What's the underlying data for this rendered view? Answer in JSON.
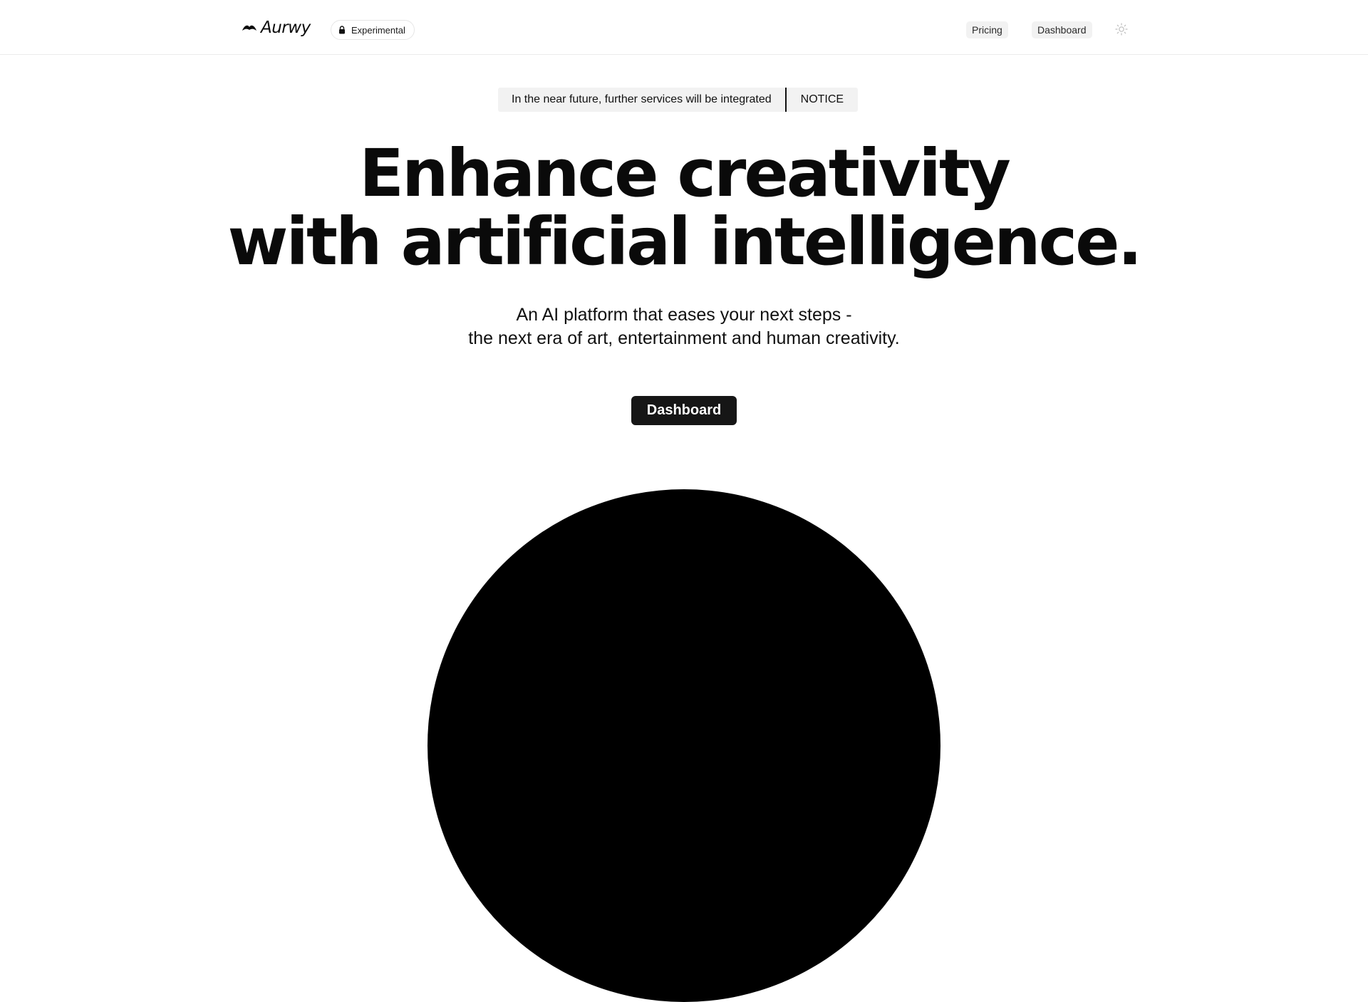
{
  "header": {
    "brand_name": "Aurwy",
    "badge_label": "Experimental",
    "nav": {
      "pricing": "Pricing",
      "dashboard": "Dashboard"
    },
    "theme_icon": "sun-icon"
  },
  "notice": {
    "text": "In the near future, further services will be integrated",
    "tag": "NOTICE"
  },
  "hero": {
    "title_line1": "Enhance creativity",
    "title_line2": "with artificial intelligence.",
    "subtitle_line1": "An AI platform that eases your next steps -",
    "subtitle_line2": "the next era of art, entertainment and human creativity.",
    "cta_label": "Dashboard"
  },
  "colors": {
    "text": "#0b0b0b",
    "cta_background": "#161616",
    "pill_background": "#f2f2f2",
    "orb": "#000000"
  }
}
